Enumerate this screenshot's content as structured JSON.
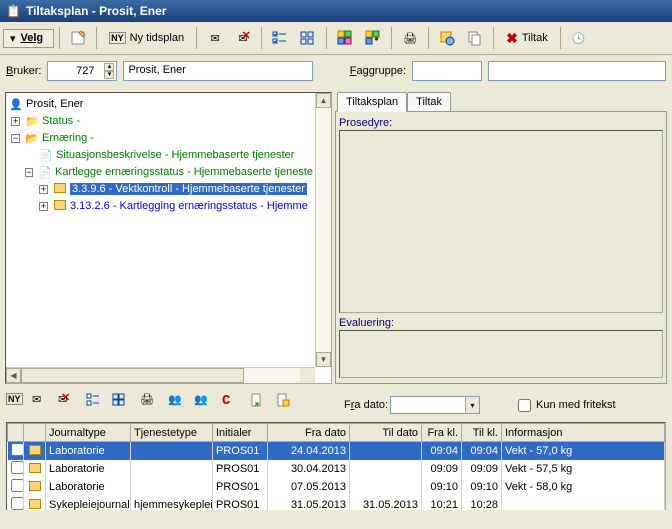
{
  "window_title": "Tiltaksplan - Prosit, Ener",
  "toolbar": {
    "velg": "Velg",
    "ny_tidsplan": "Ny tidsplan",
    "tiltak": "Tiltak"
  },
  "filters": {
    "bruker_label": "Bruker:",
    "bruker_id": "727",
    "bruker_name": "Prosit, Ener",
    "faggruppe_label": "Faggruppe:"
  },
  "tree": {
    "root": "Prosit, Ener",
    "status": "Status -",
    "ernaering": "Ernæring -",
    "situasjon": "Situasjonsbeskrivelse - Hjemmebaserte tjenester",
    "kartlegge": "Kartlegge ernæringsstatus - Hjemmebaserte tjeneste",
    "vekt": "3.3.9.6 - Vektkontroll - Hjemmebaserte tjenester",
    "kartlegging": "3.13.2.6 - Kartlegging ernæringsstatus - Hjemme"
  },
  "right": {
    "tab1": "Tiltaksplan",
    "tab2": "Tiltak",
    "prosedyre": "Prosedyre:",
    "evaluering": "Evaluering:"
  },
  "lowbar": {
    "fra_dato": "Fra dato:",
    "kun_med": "Kun med fritekst"
  },
  "grid": {
    "headers": {
      "journaltype": "Journaltype",
      "tjenestetype": "Tjenestetype",
      "initialer": "Initialer",
      "fra_dato": "Fra dato",
      "til_dato": "Til dato",
      "fra_kl": "Fra kl.",
      "til_kl": "Til kl.",
      "informasjon": "Informasjon"
    },
    "rows": [
      {
        "journaltype": "Laboratorie",
        "tjenestetype": "",
        "initialer": "PROS01",
        "fra_dato": "24.04.2013",
        "til_dato": "",
        "fra_kl": "09:04",
        "til_kl": "09:04",
        "informasjon": "Vekt - 57,0  kg",
        "sel": true
      },
      {
        "journaltype": "Laboratorie",
        "tjenestetype": "",
        "initialer": "PROS01",
        "fra_dato": "30.04.2013",
        "til_dato": "",
        "fra_kl": "09:09",
        "til_kl": "09:09",
        "informasjon": "Vekt - 57,5  kg",
        "sel": false
      },
      {
        "journaltype": "Laboratorie",
        "tjenestetype": "",
        "initialer": "PROS01",
        "fra_dato": "07.05.2013",
        "til_dato": "",
        "fra_kl": "09:10",
        "til_kl": "09:10",
        "informasjon": "Vekt - 58,0  kg",
        "sel": false
      },
      {
        "journaltype": "Sykepleiejournal",
        "tjenestetype": "hjemmesykepleie",
        "initialer": "PROS01",
        "fra_dato": "31.05.2013",
        "til_dato": "31.05.2013",
        "fra_kl": "10:21",
        "til_kl": "10:28",
        "informasjon": "",
        "sel": false
      }
    ]
  }
}
